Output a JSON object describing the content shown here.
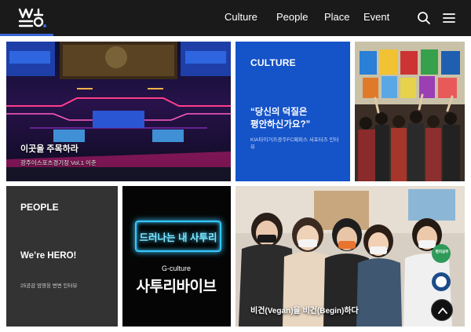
{
  "header": {
    "logo_label": "",
    "nav": [
      {
        "label": "Culture"
      },
      {
        "label": "People"
      },
      {
        "label": "Place"
      },
      {
        "label": "Event"
      }
    ]
  },
  "tiles": {
    "esports": {
      "title": "이곳을 주목하라",
      "subtitle": "광주이스포츠경기장 Vol.1 이춘"
    },
    "culture": {
      "label": "CULTURE",
      "title_line1": "“당신의 덕질은",
      "title_line2": "평안하신가요?”",
      "subtitle": "KIA타이거즈광주FC페퍼스 서포터즈 인터뷰"
    },
    "people": {
      "label": "PEOPLE",
      "title": "We’re HERO!",
      "subtitle": "25공감 엄영웅 변변 인터뷰"
    },
    "saturi": {
      "neon_text": "드러나는 내 사투리",
      "kicker": "G-culture",
      "title": "사투리바이브"
    },
    "vegan": {
      "caption": "비건(Vegan)을 비건(Begin)하다",
      "badge_text": "편지공부"
    }
  },
  "colors": {
    "header_bg": "#1a1a1a",
    "accent_blue": "#1553c8",
    "people_bg": "#333333"
  },
  "icons": {
    "search": "search-icon",
    "menu": "menu-icon",
    "scroll_top": "chevron-up-icon"
  }
}
